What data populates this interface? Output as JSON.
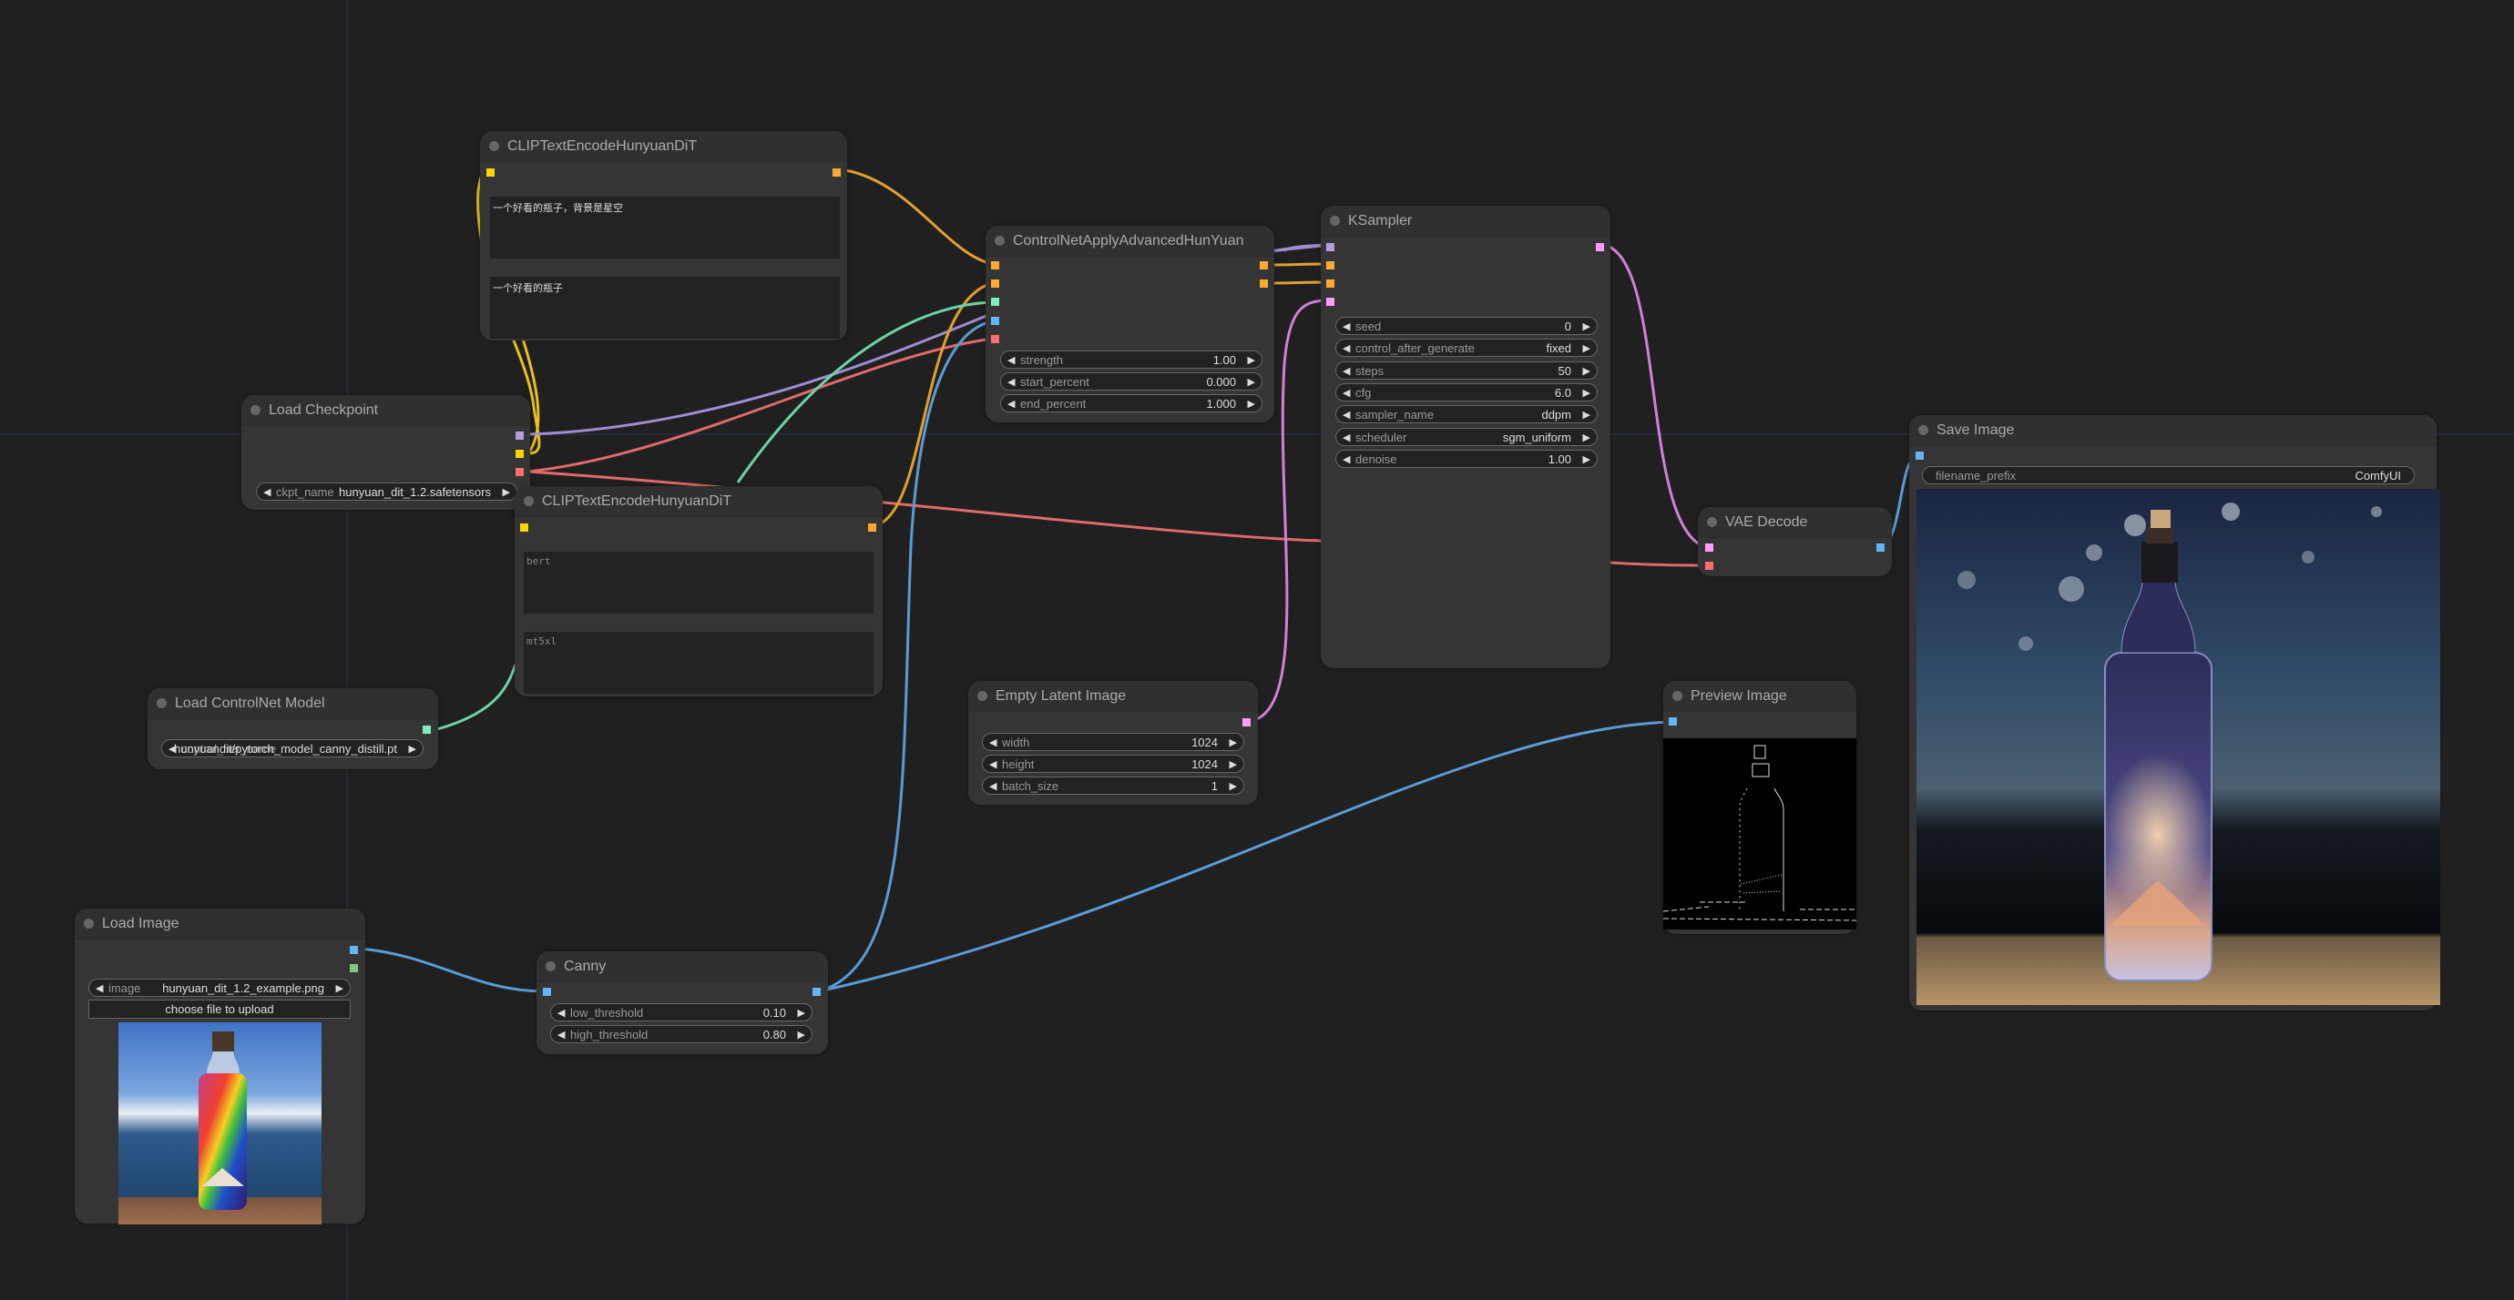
{
  "canvas": {
    "link_colors": {
      "model": "#b39ddb",
      "clip": "#ffd500",
      "vae": "#ff6e6e",
      "conditioning": "#ffa931",
      "control_net": "#7eeec1",
      "image": "#64b5f6",
      "latent": "#ff9cf9",
      "mask": "#81c784"
    }
  },
  "nodes": {
    "clip_text_encode_1": {
      "title": "CLIPTextEncodeHunyuanDiT",
      "bert_text": "一个好看的瓶子，背景是星空",
      "mt5xl_text": "一个好看的瓶子"
    },
    "load_checkpoint": {
      "title": "Load Checkpoint",
      "widgets": [
        {
          "label": "ckpt_name",
          "value": "hunyuan_dit_1.2.safetensors"
        }
      ]
    },
    "clip_text_encode_2": {
      "title": "CLIPTextEncodeHunyuanDiT",
      "bert_placeholder": "bert",
      "mt5xl_placeholder": "mt5xl"
    },
    "controlnet_apply": {
      "title": "ControlNetApplyAdvancedHunYuan",
      "widgets": [
        {
          "label": "strength",
          "value": "1.00"
        },
        {
          "label": "start_percent",
          "value": "0.000"
        },
        {
          "label": "end_percent",
          "value": "1.000"
        }
      ]
    },
    "ksampler": {
      "title": "KSampler",
      "widgets": [
        {
          "label": "seed",
          "value": "0"
        },
        {
          "label": "control_after_generate",
          "value": "fixed"
        },
        {
          "label": "steps",
          "value": "50"
        },
        {
          "label": "cfg",
          "value": "6.0"
        },
        {
          "label": "sampler_name",
          "value": "ddpm"
        },
        {
          "label": "scheduler",
          "value": "sgm_uniform"
        },
        {
          "label": "denoise",
          "value": "1.00"
        }
      ]
    },
    "load_controlnet": {
      "title": "Load ControlNet Model",
      "widgets": [
        {
          "label": "control_net_name",
          "value": "hunyuandit/pytorch_model_canny_distill.pt"
        }
      ]
    },
    "empty_latent": {
      "title": "Empty Latent Image",
      "widgets": [
        {
          "label": "width",
          "value": "1024"
        },
        {
          "label": "height",
          "value": "1024"
        },
        {
          "label": "batch_size",
          "value": "1"
        }
      ]
    },
    "vae_decode": {
      "title": "VAE Decode"
    },
    "save_image": {
      "title": "Save Image",
      "widgets": [
        {
          "label": "filename_prefix",
          "value": "ComfyUI"
        }
      ]
    },
    "preview_image": {
      "title": "Preview Image"
    },
    "load_image": {
      "title": "Load Image",
      "widgets": [
        {
          "label": "image",
          "value": "hunyuan_dit_1.2_example.png"
        }
      ],
      "upload_label": "choose file to upload"
    },
    "canny": {
      "title": "Canny",
      "widgets": [
        {
          "label": "low_threshold",
          "value": "0.10"
        },
        {
          "label": "high_threshold",
          "value": "0.80"
        }
      ]
    }
  }
}
